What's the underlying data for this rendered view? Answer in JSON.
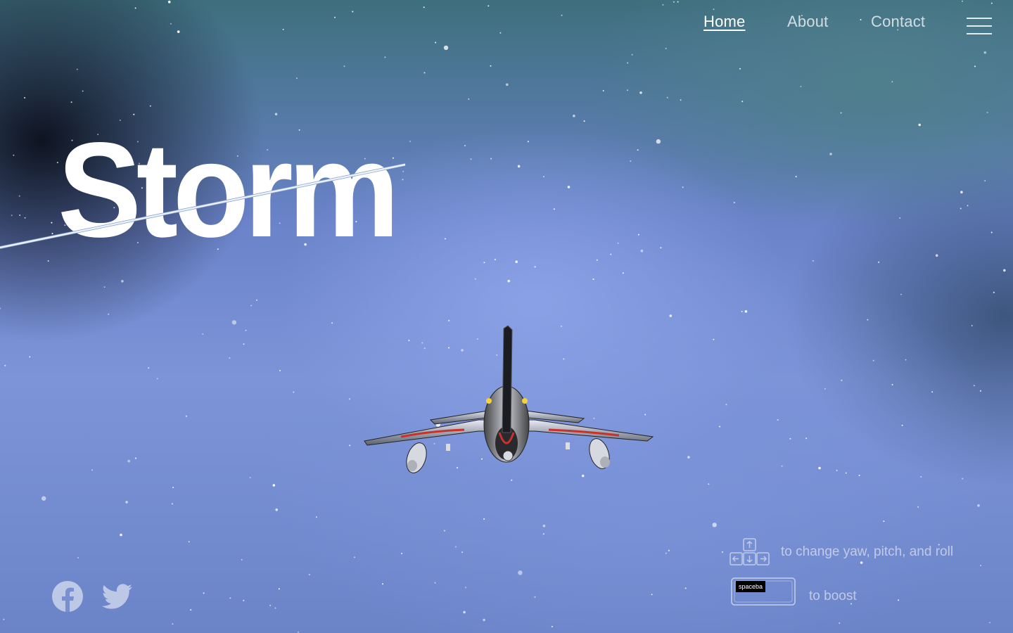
{
  "brand": {
    "logo_text": "Storm"
  },
  "nav": {
    "items": [
      {
        "label": "Home",
        "active": true
      },
      {
        "label": "About",
        "active": false
      },
      {
        "label": "Contact",
        "active": false
      }
    ],
    "menu_icon": "hamburger-menu-icon"
  },
  "controls": {
    "arrows_hint": "to change yaw, pitch, and roll",
    "spacebar_hint": "to boost",
    "spacebar_key_label": "spaceba",
    "arrow_icon": "arrow-keys-icon",
    "spacebar_icon": "spacebar-key-icon"
  },
  "social": [
    {
      "name": "facebook",
      "icon": "facebook-icon"
    },
    {
      "name": "twitter",
      "icon": "twitter-icon"
    }
  ],
  "colors": {
    "sky_top": "#3e6f7d",
    "sky_mid": "#7d94d8",
    "text_white": "#ffffff",
    "plane_accent": "#c8322a"
  }
}
